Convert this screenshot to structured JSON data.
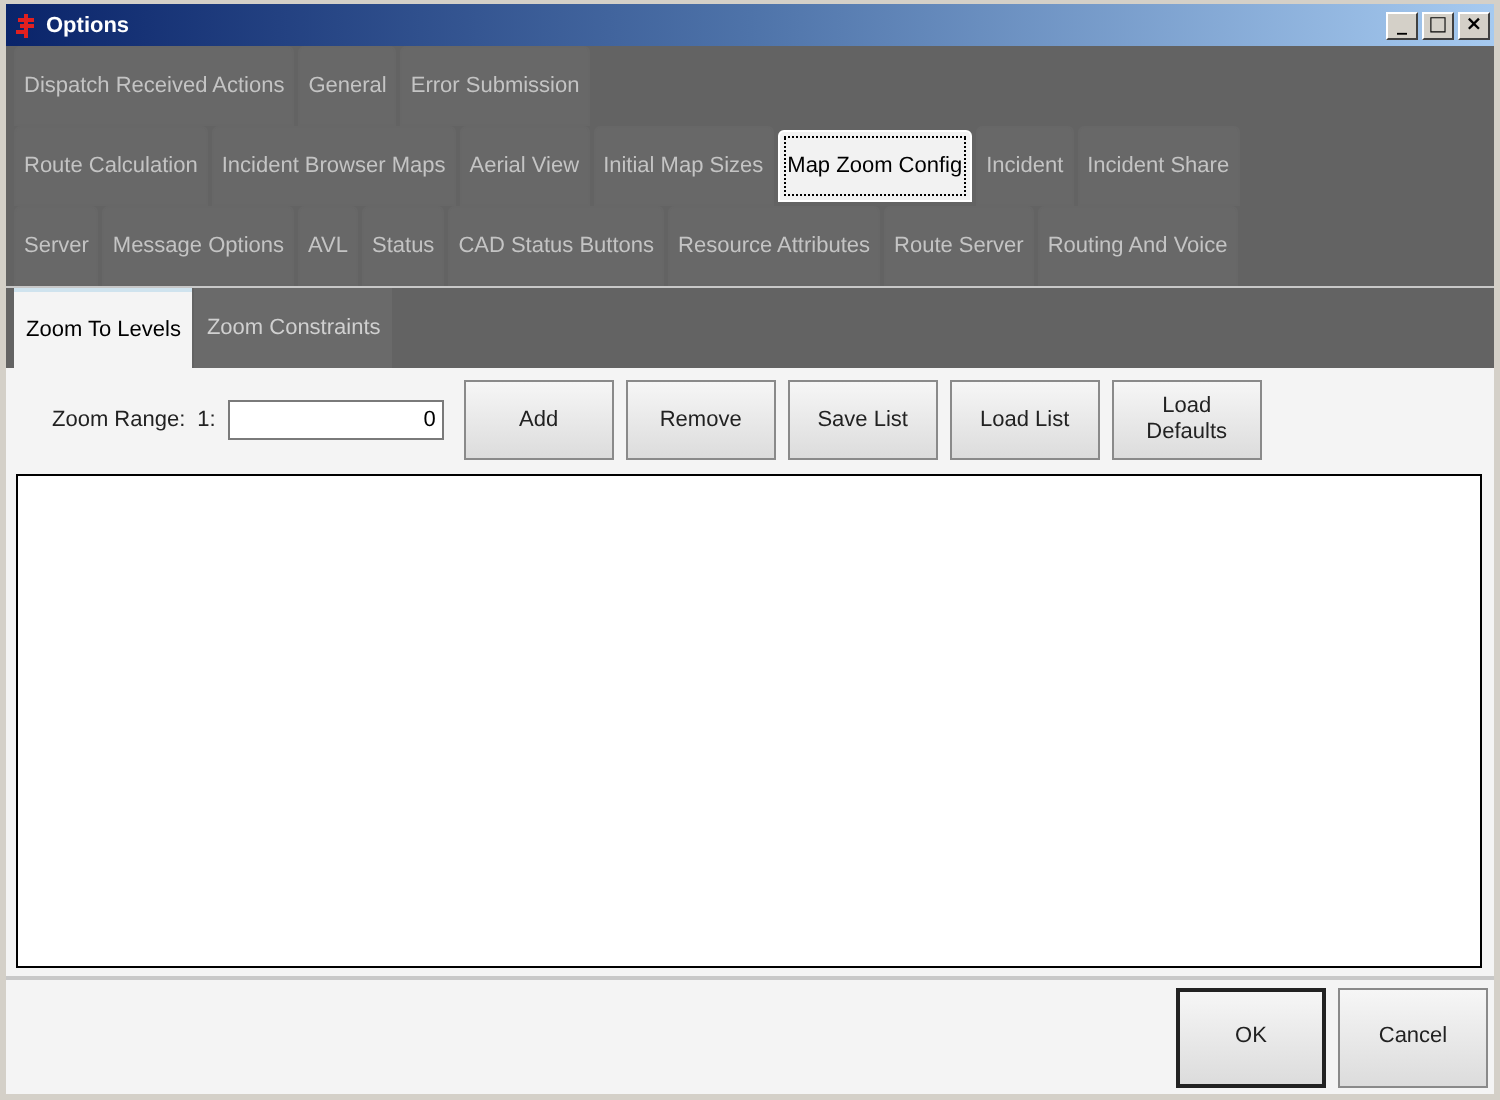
{
  "window": {
    "title": "Options"
  },
  "title_buttons": [
    "_",
    "□",
    "×"
  ],
  "tab_rows": [
    [
      {
        "label": "Dispatch Received Actions",
        "selected": false
      },
      {
        "label": "General",
        "selected": false
      },
      {
        "label": "Error Submission",
        "selected": false
      }
    ],
    [
      {
        "label": "Route Calculation",
        "selected": false
      },
      {
        "label": "Incident Browser Maps",
        "selected": false
      },
      {
        "label": "Aerial View",
        "selected": false
      },
      {
        "label": "Initial Map Sizes",
        "selected": false
      },
      {
        "label": "Map Zoom Config",
        "selected": true
      },
      {
        "label": "Incident",
        "selected": false
      },
      {
        "label": "Incident Share",
        "selected": false
      }
    ],
    [
      {
        "label": "Server",
        "selected": false
      },
      {
        "label": "Message Options",
        "selected": false
      },
      {
        "label": "AVL",
        "selected": false
      },
      {
        "label": "Status",
        "selected": false
      },
      {
        "label": "CAD Status Buttons",
        "selected": false
      },
      {
        "label": "Resource Attributes",
        "selected": false
      },
      {
        "label": "Route Server",
        "selected": false
      },
      {
        "label": "Routing And Voice",
        "selected": false
      }
    ]
  ],
  "sub_tabs": [
    {
      "label": "Zoom To Levels",
      "selected": true
    },
    {
      "label": "Zoom Constraints",
      "selected": false
    }
  ],
  "zoom_range": {
    "label": "Zoom Range:",
    "prefix": "1:",
    "value": "0"
  },
  "actions": [
    "Add",
    "Remove",
    "Save List",
    "Load List",
    "Load\nDefaults"
  ],
  "footer_buttons": [
    {
      "label": "OK",
      "default": true
    },
    {
      "label": "Cancel",
      "default": false
    }
  ]
}
